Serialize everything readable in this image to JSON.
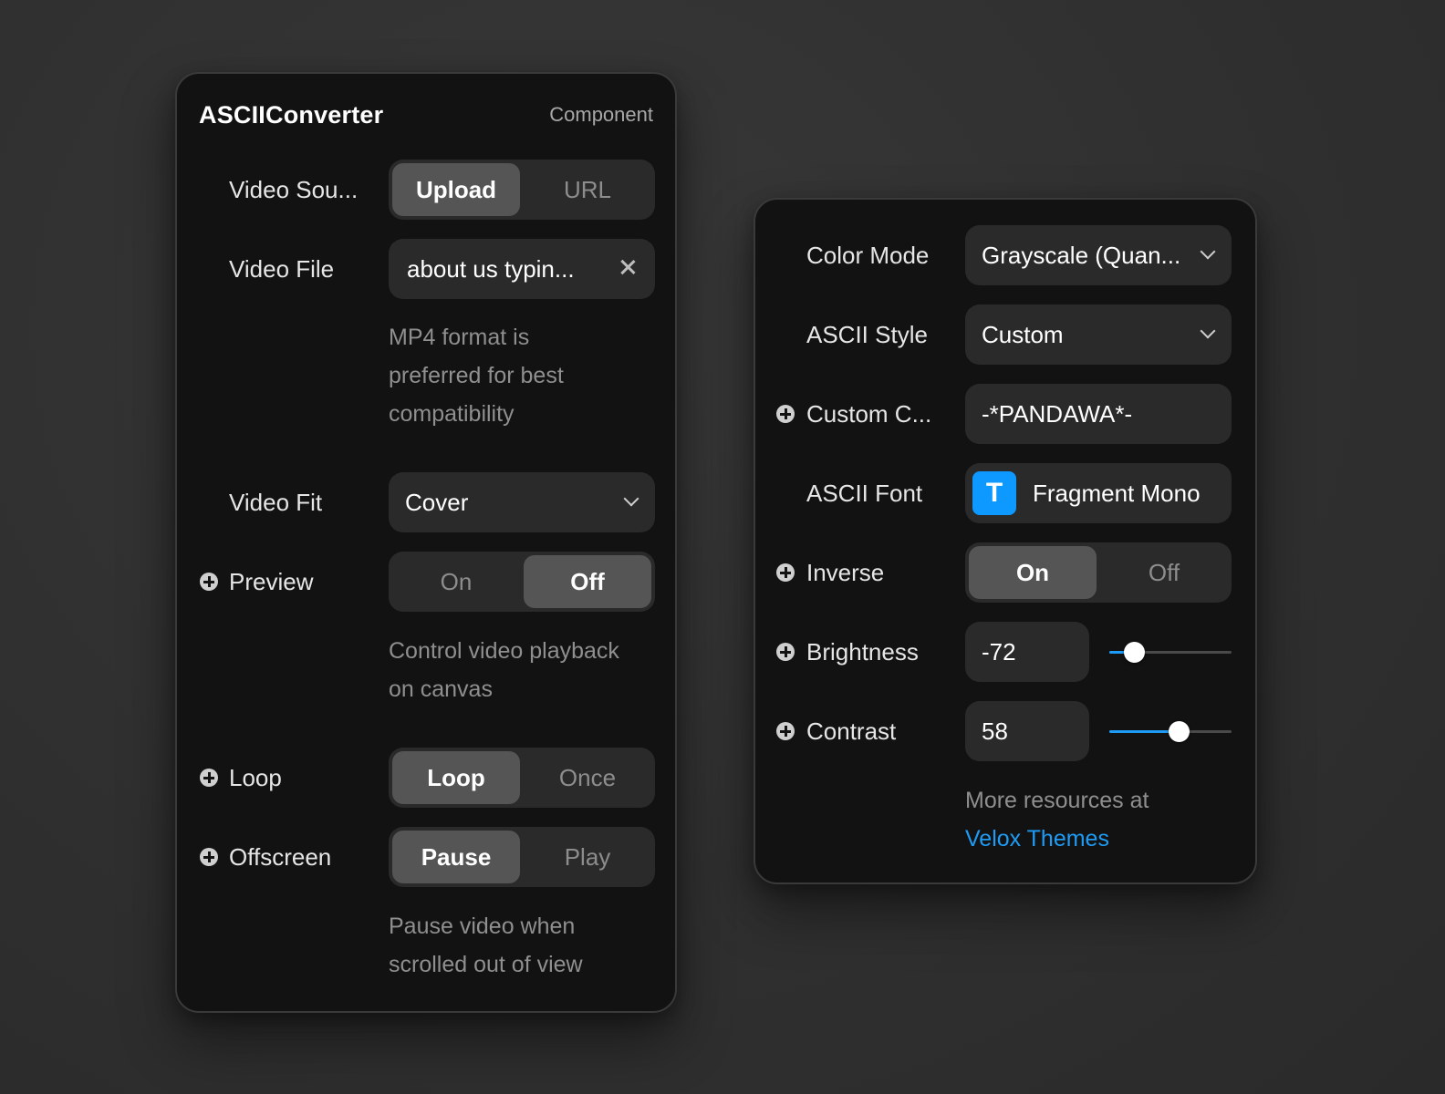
{
  "left_panel": {
    "title": "ASCIIConverter",
    "subtitle": "Component",
    "video_source": {
      "label": "Video Sou...",
      "options": [
        "Upload",
        "URL"
      ],
      "selected": "Upload"
    },
    "video_file": {
      "label": "Video File",
      "value": "about us typin...",
      "help": [
        "MP4 format is",
        "preferred for best",
        "compatibility"
      ]
    },
    "video_fit": {
      "label": "Video Fit",
      "value": "Cover"
    },
    "preview": {
      "label": "Preview",
      "options": [
        "On",
        "Off"
      ],
      "selected": "Off",
      "help": [
        "Control video playback",
        "on canvas"
      ]
    },
    "loop": {
      "label": "Loop",
      "options": [
        "Loop",
        "Once"
      ],
      "selected": "Loop"
    },
    "offscreen": {
      "label": "Offscreen",
      "options": [
        "Pause",
        "Play"
      ],
      "selected": "Pause",
      "help": [
        "Pause video when",
        "scrolled out of view"
      ]
    }
  },
  "right_panel": {
    "color_mode": {
      "label": "Color Mode",
      "value": "Grayscale (Quan..."
    },
    "ascii_style": {
      "label": "ASCII Style",
      "value": "Custom"
    },
    "custom_chars": {
      "label": "Custom C...",
      "value": "-*PANDAWA*-"
    },
    "ascii_font": {
      "label": "ASCII Font",
      "icon_letter": "T",
      "value": "Fragment Mono"
    },
    "inverse": {
      "label": "Inverse",
      "options": [
        "On",
        "Off"
      ],
      "selected": "On"
    },
    "brightness": {
      "label": "Brightness",
      "value": "-72",
      "slider_fraction": 0.2
    },
    "contrast": {
      "label": "Contrast",
      "value": "58",
      "slider_fraction": 0.57
    },
    "footer": {
      "text": "More resources at",
      "link": "Velox Themes"
    }
  },
  "colors": {
    "accent": "#1e9bf5",
    "panel_bg": "#121212",
    "control_bg": "#2a2a2a",
    "active_segment": "#555555"
  },
  "icons": {
    "add": "plus-circle-icon",
    "clear": "close-icon",
    "dropdown": "chevron-down-icon",
    "font": "type-icon"
  }
}
